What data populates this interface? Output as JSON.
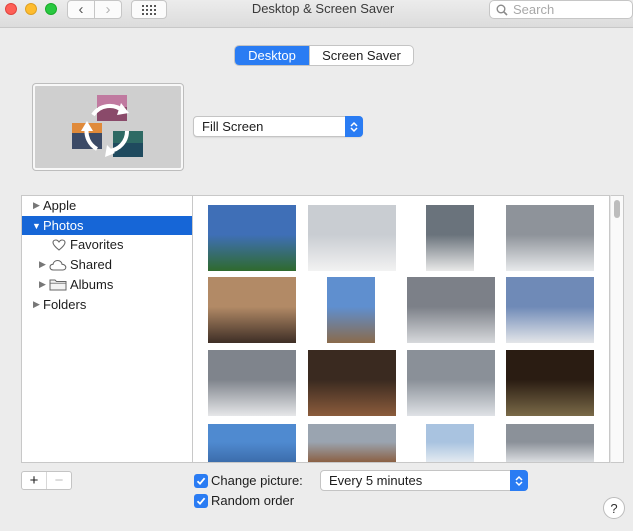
{
  "window": {
    "title": "Desktop & Screen Saver",
    "search_placeholder": "Search"
  },
  "tabs": [
    {
      "label": "Desktop",
      "selected": true
    },
    {
      "label": "Screen Saver",
      "selected": false
    }
  ],
  "fill_mode": {
    "value": "Fill Screen"
  },
  "sidebar": {
    "items": [
      {
        "label": "Apple",
        "level": 0,
        "expanded": false
      },
      {
        "label": "Photos",
        "level": 0,
        "expanded": true,
        "selected": true
      },
      {
        "label": "Favorites",
        "level": 1,
        "icon": "heart-icon"
      },
      {
        "label": "Shared",
        "level": 1,
        "icon": "cloud-icon",
        "expanded": false
      },
      {
        "label": "Albums",
        "level": 1,
        "icon": "folder-icon",
        "expanded": false
      },
      {
        "label": "Folders",
        "level": 0,
        "expanded": false
      }
    ]
  },
  "photos": [
    {
      "subject": "lighthouse by water",
      "palette": [
        "#3f6fb7",
        "#2f6a2d"
      ]
    },
    {
      "subject": "white house in snow",
      "palette": [
        "#c9cdd2",
        "#f2f2f2"
      ]
    },
    {
      "subject": "house corner",
      "palette": [
        "#6a737c",
        "#e9e9e9"
      ]
    },
    {
      "subject": "snowy trees",
      "palette": [
        "#8e939a",
        "#e8eaec"
      ]
    },
    {
      "subject": "couple portrait",
      "palette": [
        "#b28a66",
        "#3e2e26"
      ]
    },
    {
      "subject": "lighthouse tower",
      "palette": [
        "#5f8fcf",
        "#8a6b4b"
      ]
    },
    {
      "subject": "snowy branches",
      "palette": [
        "#7c8088",
        "#d7d9dc"
      ]
    },
    {
      "subject": "house with snowy bush",
      "palette": [
        "#6f8ab7",
        "#e4e6e9"
      ]
    },
    {
      "subject": "snowy tree",
      "palette": [
        "#7f848c",
        "#e6e7e9"
      ]
    },
    {
      "subject": "party room",
      "palette": [
        "#3a2a20",
        "#8c5c3c"
      ]
    },
    {
      "subject": "snowy street",
      "palette": [
        "#8a9098",
        "#dfe2e6"
      ]
    },
    {
      "subject": "window interior",
      "palette": [
        "#2a1c12",
        "#7a6a48"
      ]
    },
    {
      "subject": "beach shore",
      "palette": [
        "#4f8ad0",
        "#3a6aa8"
      ]
    },
    {
      "subject": "house in snow",
      "palette": [
        "#9aa4b0",
        "#8a5a3a"
      ]
    },
    {
      "subject": "lighthouse",
      "palette": [
        "#a9c3e0",
        "#e9eef2"
      ]
    },
    {
      "subject": "snowy trees",
      "palette": [
        "#8b9199",
        "#e3e5e8"
      ]
    }
  ],
  "options": {
    "change_picture": {
      "label": "Change picture:",
      "checked": true
    },
    "interval": {
      "value": "Every 5 minutes"
    },
    "random_order": {
      "label": "Random order",
      "checked": true
    }
  },
  "colors": {
    "accent": "#2a7cf3",
    "selection": "#1666d7"
  },
  "buttons": {
    "add": "+",
    "remove": "−",
    "help": "?"
  }
}
